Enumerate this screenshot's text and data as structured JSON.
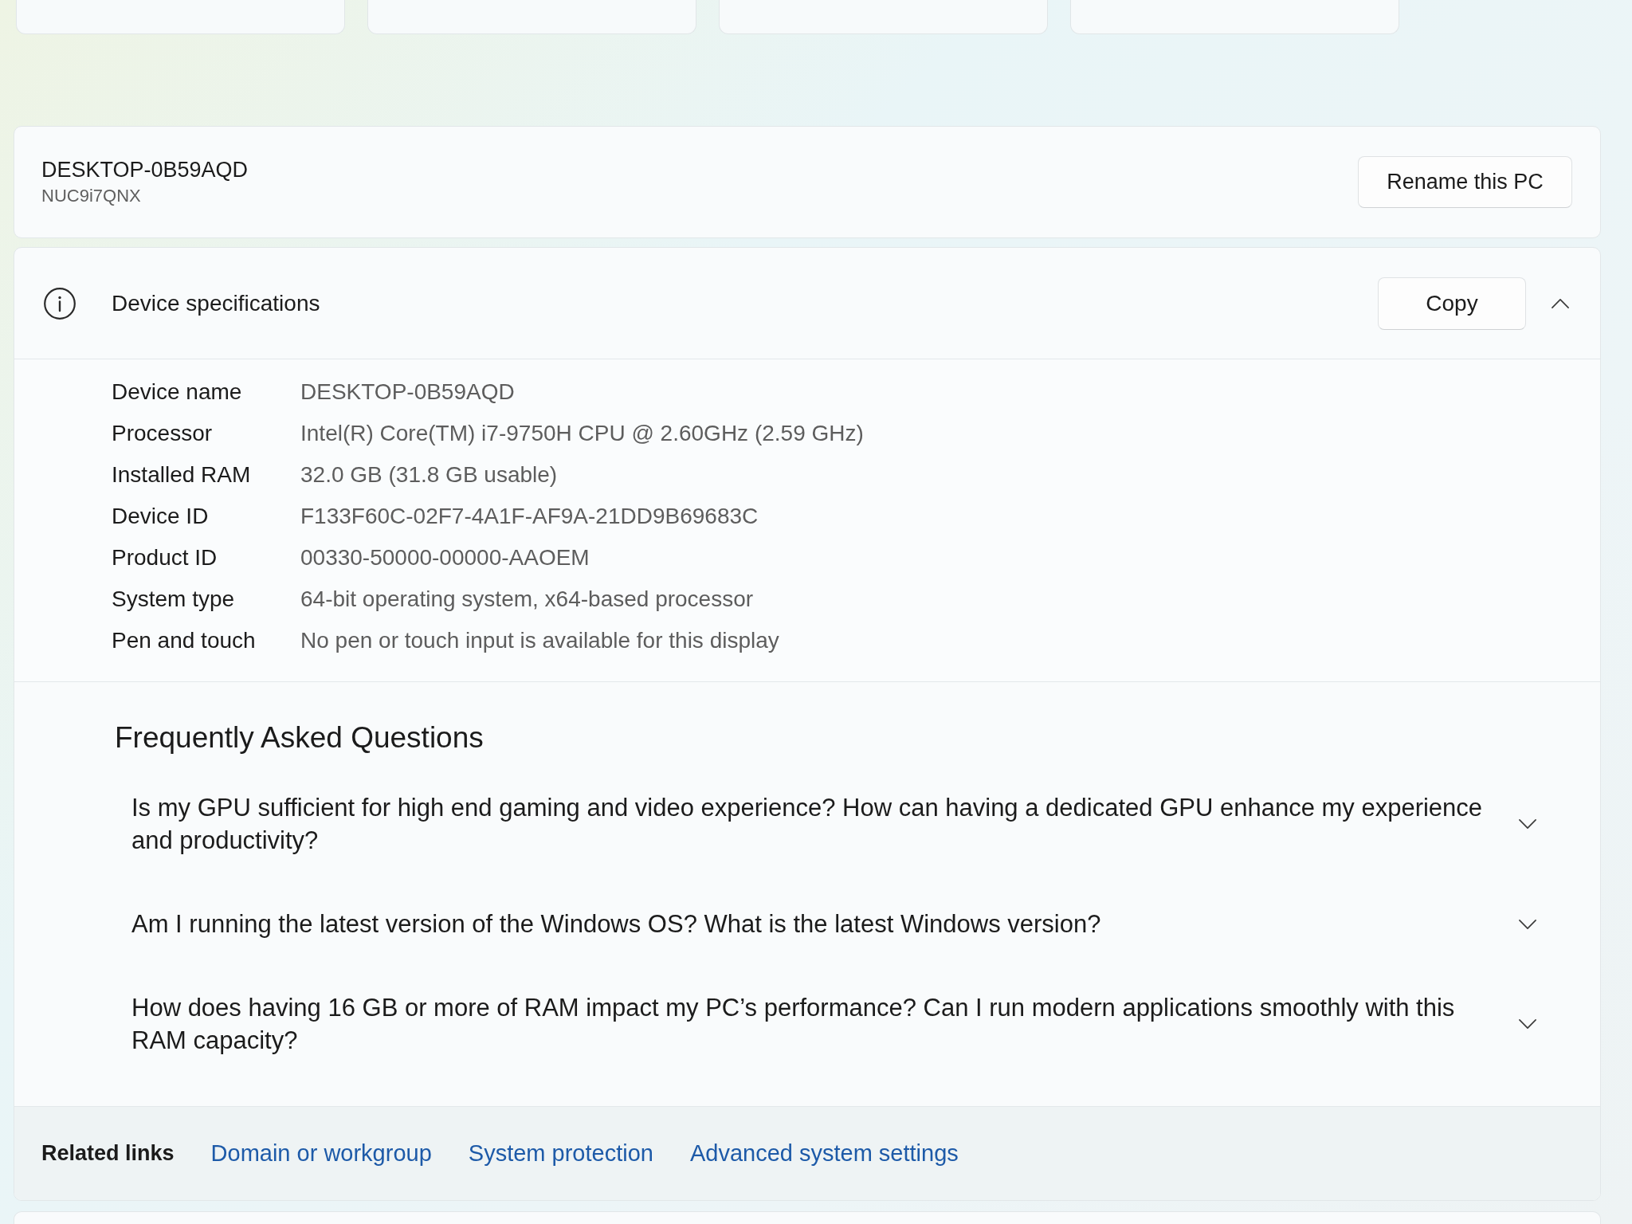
{
  "pc": {
    "name": "DESKTOP-0B59AQD",
    "model": "NUC9i7QNX",
    "rename_button": "Rename this PC"
  },
  "device_specifications": {
    "title": "Device specifications",
    "copy_button": "Copy",
    "expanded": true,
    "specs": [
      {
        "label": "Device name",
        "value": "DESKTOP-0B59AQD"
      },
      {
        "label": "Processor",
        "value": "Intel(R) Core(TM) i7-9750H CPU @ 2.60GHz (2.59 GHz)"
      },
      {
        "label": "Installed RAM",
        "value": "32.0 GB (31.8 GB usable)"
      },
      {
        "label": "Device ID",
        "value": "F133F60C-02F7-4A1F-AF9A-21DD9B69683C"
      },
      {
        "label": "Product ID",
        "value": "00330-50000-00000-AAOEM"
      },
      {
        "label": "System type",
        "value": "64-bit operating system, x64-based processor"
      },
      {
        "label": "Pen and touch",
        "value": "No pen or touch input is available for this display"
      }
    ]
  },
  "faq": {
    "title": "Frequently Asked Questions",
    "items": [
      {
        "question": "Is my GPU sufficient for high end gaming and video experience? How can having a dedicated GPU enhance my experience and productivity?",
        "expanded": false
      },
      {
        "question": "Am I running the latest version of the Windows OS? What is the latest Windows version?",
        "expanded": false
      },
      {
        "question": "How does having 16 GB or more of RAM impact my PC’s performance? Can I run modern applications smoothly with this RAM capacity?",
        "expanded": false
      }
    ]
  },
  "related_links": {
    "label": "Related links",
    "links": [
      "Domain or workgroup",
      "System protection",
      "Advanced system settings"
    ]
  }
}
